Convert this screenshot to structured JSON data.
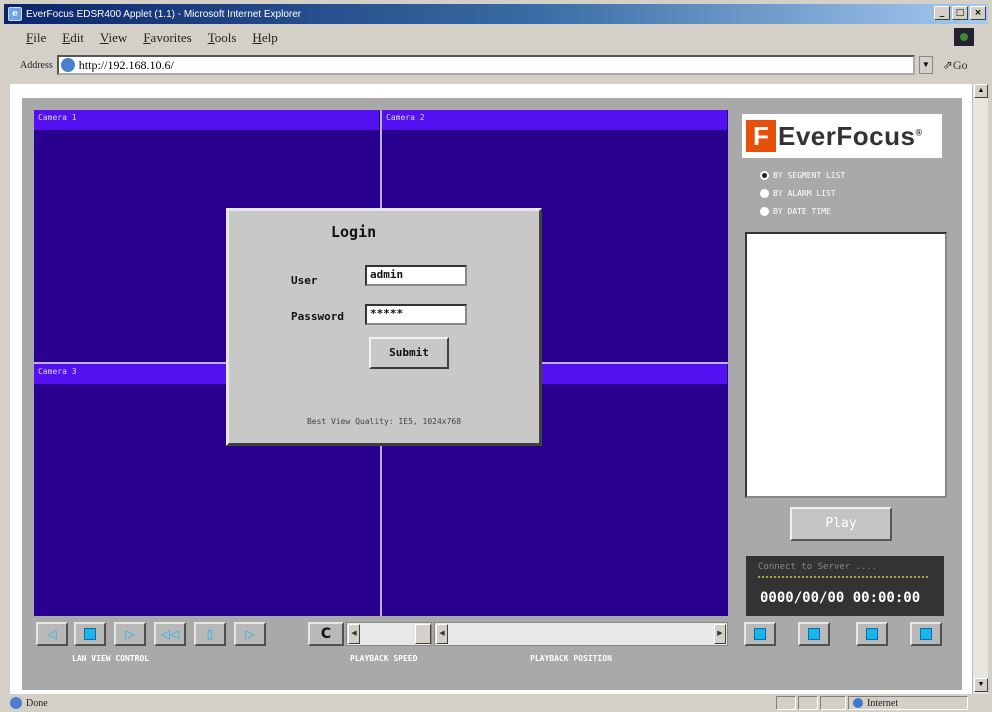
{
  "window": {
    "title": "EverFocus EDSR400 Applet (1.1) - Microsoft Internet Explorer",
    "buttons": [
      "_",
      "□",
      "×"
    ]
  },
  "menu": [
    "File",
    "Edit",
    "View",
    "Favorites",
    "Tools",
    "Help"
  ],
  "address": {
    "label": "Address",
    "url": "http://192.168.10.6/",
    "go_label": "Go"
  },
  "cameras": [
    {
      "label": "Camera 1"
    },
    {
      "label": "Camera 2"
    },
    {
      "label": "Camera 3"
    },
    {
      "label": ""
    }
  ],
  "login": {
    "title": "Login",
    "user_label": "User",
    "user_value": "admin",
    "password_label": "Password",
    "password_value": "*****",
    "submit_label": "Submit",
    "hint": "Best View Quality: IE5, 1024x768"
  },
  "brand": {
    "mark": "F",
    "name": "EverFocus",
    "reg": "®"
  },
  "search_modes": [
    {
      "label": "BY SEGMENT LIST",
      "selected": true
    },
    {
      "label": "BY ALARM LIST",
      "selected": false
    },
    {
      "label": "BY DATE TIME",
      "selected": false
    }
  ],
  "play_label": "Play",
  "connection": {
    "message": "Connect to Server ....",
    "datetime": "0000/00/00 00:00:00"
  },
  "controls": {
    "live_view_label": "LAN VIEW CONTROL",
    "playback_speed_label": "PLAYBACK SPEED",
    "playback_position_label": "PLAYBACK POSITION",
    "c_label": "C",
    "live_buttons": [
      "rewind-icon",
      "stop-icon",
      "play-icon",
      "step-back-icon",
      "pause-icon",
      "step-forward-icon"
    ],
    "layout_buttons": [
      "layout-1-icon",
      "layout-2-icon",
      "layout-3-icon",
      "layout-4-icon"
    ]
  },
  "statusbar": {
    "left_text": "Done",
    "zone_text": "Internet"
  }
}
